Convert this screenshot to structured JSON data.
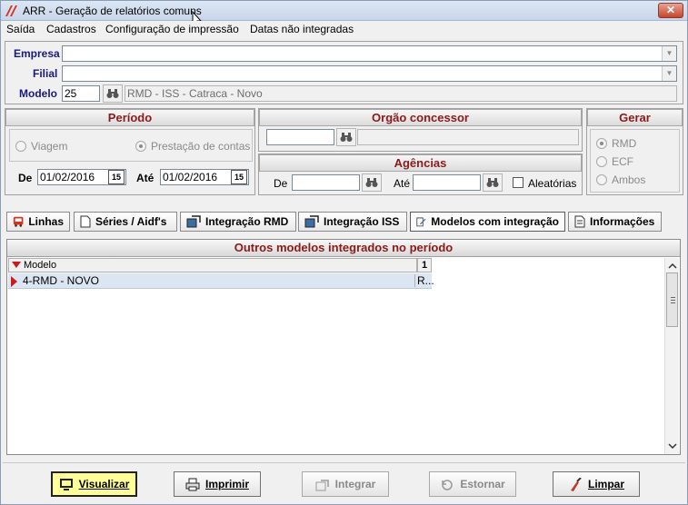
{
  "window": {
    "title": "ARR - Geração de relatórios comuns",
    "close_label": "✕"
  },
  "menu": [
    "Saída",
    "Cadastros",
    "Configuração de impressão",
    "Datas não integradas"
  ],
  "header_fields": {
    "empresa_label": "Empresa",
    "filial_label": "Filial",
    "modelo_label": "Modelo",
    "modelo_value": "25",
    "modelo_desc": "RMD - ISS - Catraca - Novo"
  },
  "periodo": {
    "title": "Período",
    "radio_viagem": "Viagem",
    "radio_prestacao": "Prestação de contas",
    "selected": "Prestação de contas",
    "de_label": "De",
    "de_value": "01/02/2016",
    "ate_label": "Até",
    "ate_value": "01/02/2016",
    "cal_icon": "15"
  },
  "orgao": {
    "title": "Orgão concessor"
  },
  "agencias": {
    "title": "Agências",
    "de_label": "De",
    "ate_label": "Até",
    "aleatorias_label": "Aleatórias",
    "aleatorias_checked": false
  },
  "gerar": {
    "title": "Gerar",
    "options": [
      "RMD",
      "ECF",
      "Ambos"
    ],
    "selected": "RMD"
  },
  "tabs": [
    {
      "label": "Linhas",
      "icon": "bus-icon"
    },
    {
      "label": "Séries / Aidf's",
      "icon": "document-icon"
    },
    {
      "label": "Integração RMD",
      "icon": "integration-icon"
    },
    {
      "label": "Integração ISS",
      "icon": "integration-icon"
    },
    {
      "label": "Modelos com integração",
      "icon": "edit-document-icon"
    },
    {
      "label": "Informações",
      "icon": "info-document-icon"
    }
  ],
  "active_tab": "Modelos com integração",
  "grid": {
    "title": "Outros modelos integrados no período",
    "col_modelo": "Modelo",
    "col_sort": "1",
    "rows": [
      {
        "modelo": "4-RMD - NOVO",
        "col2": "R..."
      }
    ]
  },
  "buttons": {
    "visualizar": "Visualizar",
    "imprimir": "Imprimir",
    "integrar": "Integrar",
    "estornar": "Estornar",
    "limpar": "Limpar"
  },
  "colors": {
    "section_title": "#8b1a1a",
    "field_label": "#1a1a7a",
    "focus_button": "#ffff99",
    "selected_row": "#dce6f2"
  }
}
